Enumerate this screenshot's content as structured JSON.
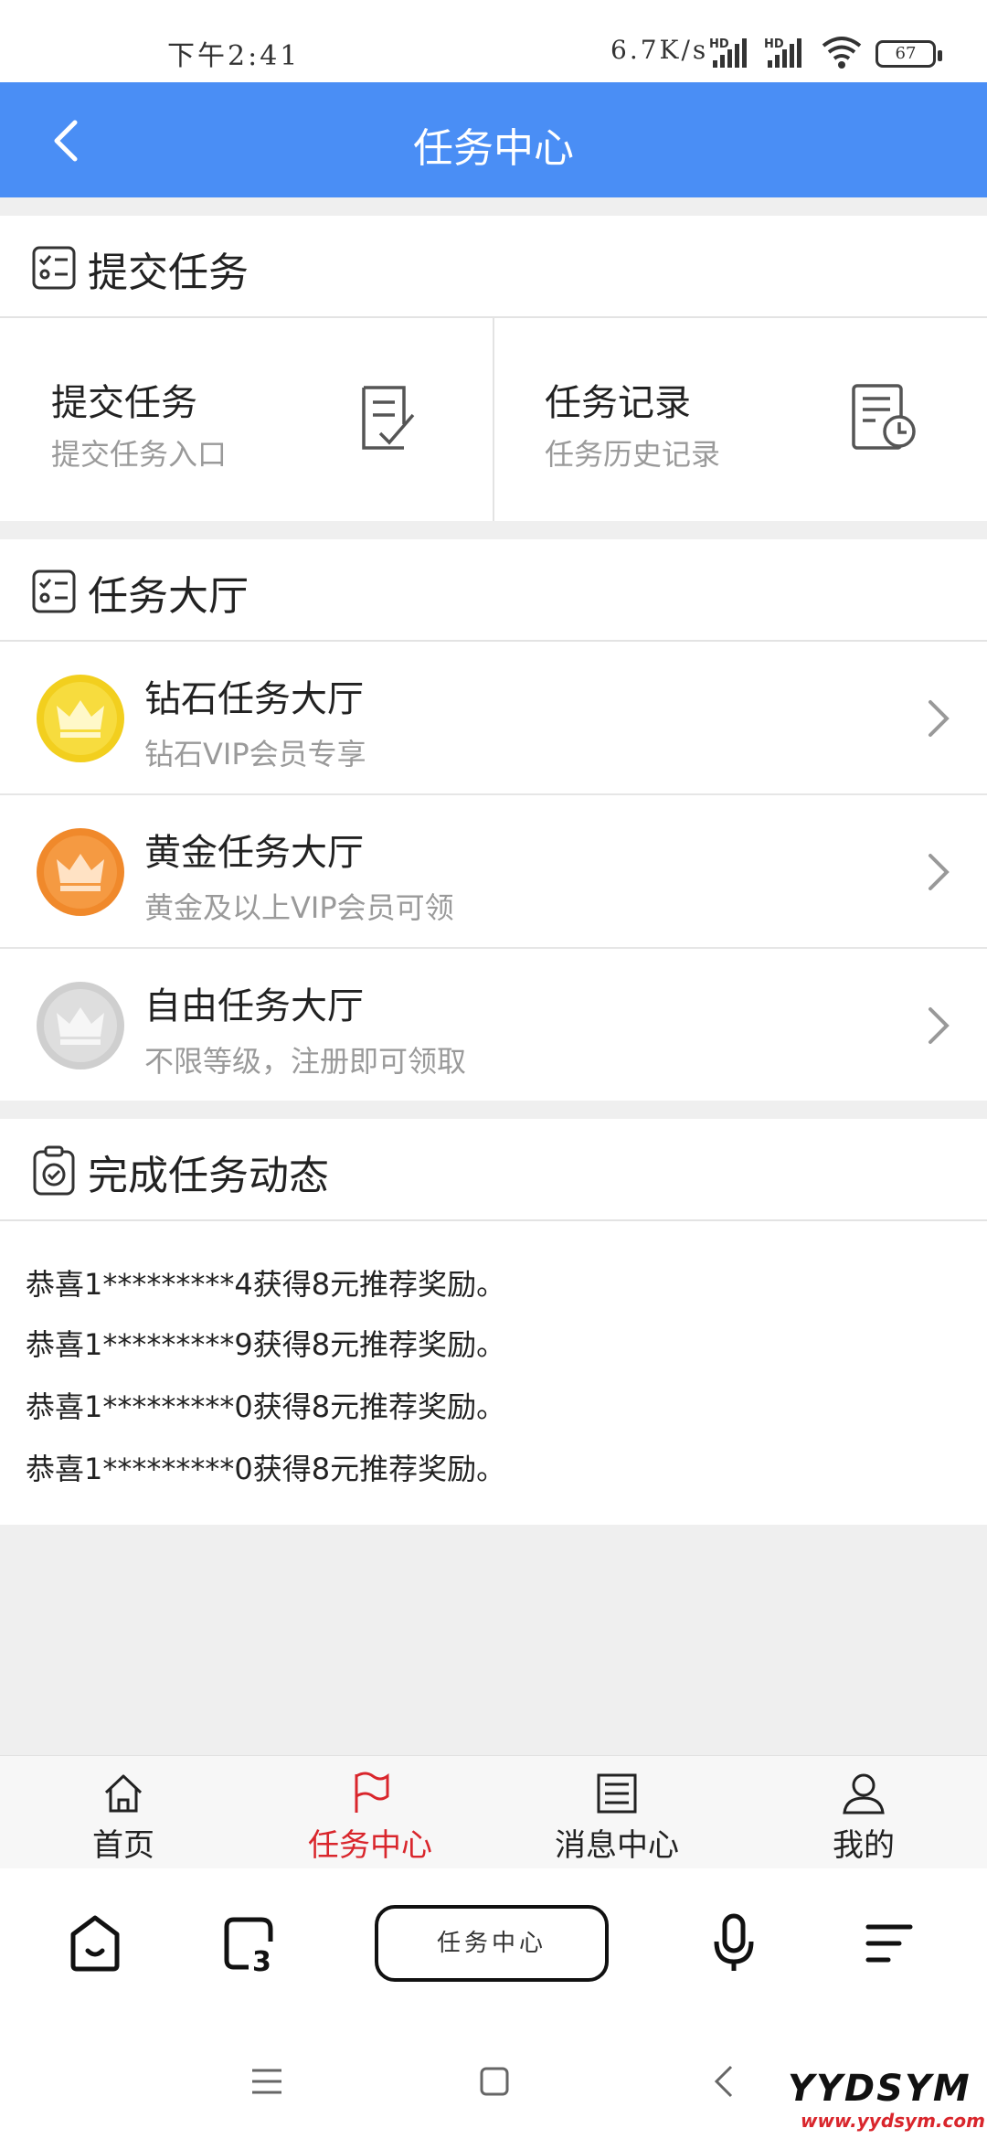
{
  "status_bar": {
    "time": "下午2:41",
    "network_speed": "6.7K/s",
    "signal_label": "HD",
    "battery": "67"
  },
  "header": {
    "title": "任务中心",
    "back_icon": "chevron-left-icon",
    "background": "#4a8ef5"
  },
  "submit_section": {
    "title": "提交任务",
    "icon": "checklist-icon",
    "items": [
      {
        "title": "提交任务",
        "subtitle": "提交任务入口",
        "icon": "document-check-icon"
      },
      {
        "title": "任务记录",
        "subtitle": "任务历史记录",
        "icon": "document-clock-icon"
      }
    ]
  },
  "hall_section": {
    "title": "任务大厅",
    "icon": "checklist-icon",
    "items": [
      {
        "title": "钻石任务大厅",
        "subtitle": "钻石VIP会员专享",
        "icon": "crown-gold-icon",
        "color": "#f2cf1e"
      },
      {
        "title": "黄金任务大厅",
        "subtitle": "黄金及以上VIP会员可领",
        "icon": "crown-orange-icon",
        "color": "#f0892b"
      },
      {
        "title": "自由任务大厅",
        "subtitle": "不限等级，注册即可领取",
        "icon": "crown-silver-icon",
        "color": "#cfcfcf"
      }
    ]
  },
  "feed_section": {
    "title": "完成任务动态",
    "icon": "clipboard-check-icon",
    "items": [
      "恭喜1*********4获得8元推荐奖励。",
      "恭喜1*********9获得8元推荐奖励。",
      "恭喜1*********0获得8元推荐奖励。",
      "恭喜1*********0获得8元推荐奖励。"
    ]
  },
  "tabbar": {
    "active_color": "#d9262c",
    "items": [
      {
        "label": "首页",
        "icon": "home-icon"
      },
      {
        "label": "任务中心",
        "icon": "flag-icon",
        "active": true
      },
      {
        "label": "消息中心",
        "icon": "list-icon"
      },
      {
        "label": "我的",
        "icon": "user-icon"
      }
    ]
  },
  "browser_bar": {
    "address": "任务中心",
    "tab_count": "3"
  },
  "watermark": {
    "brand": "YYDSYM",
    "url": "www.yydsym.com"
  }
}
